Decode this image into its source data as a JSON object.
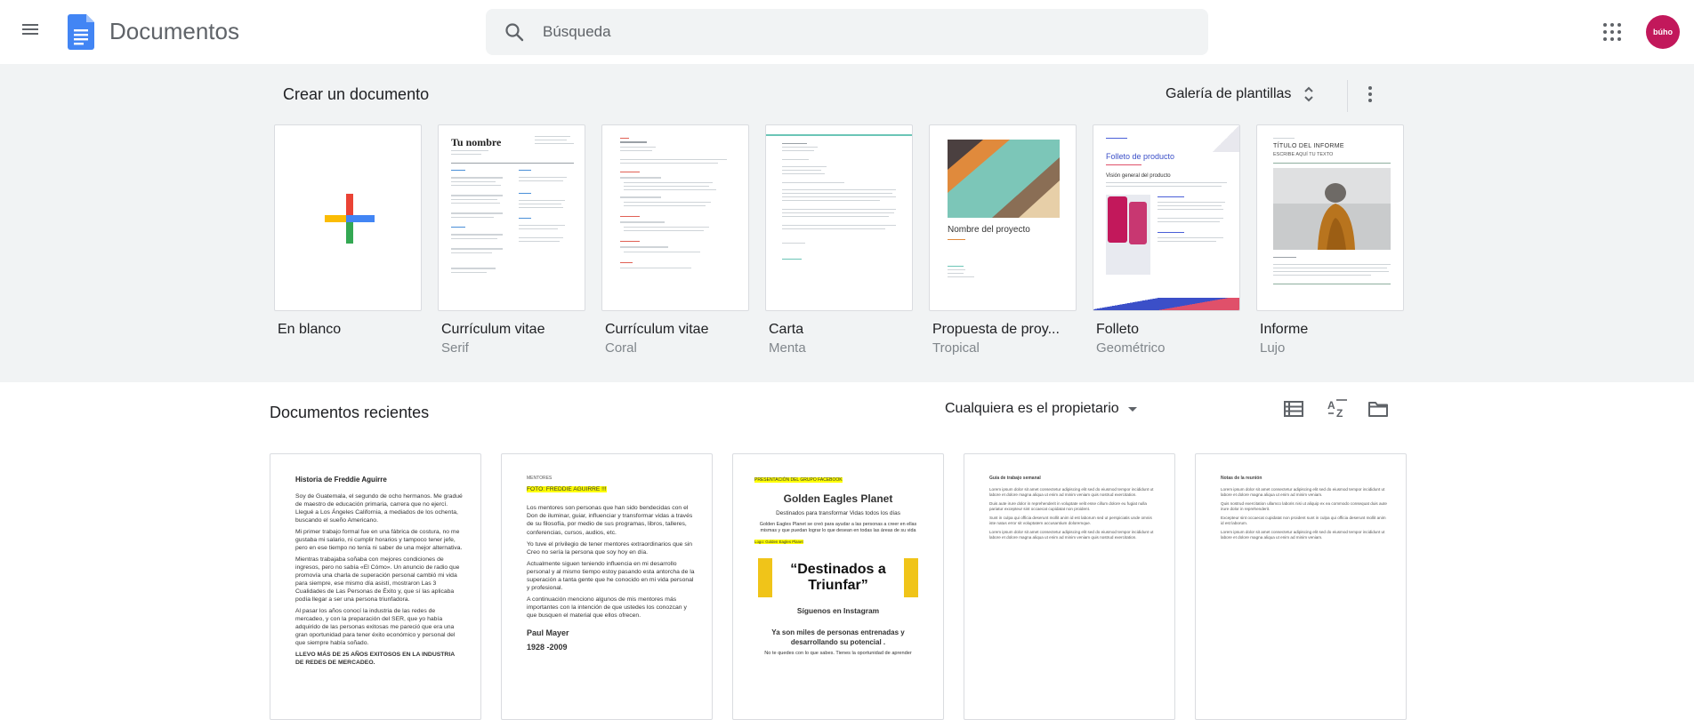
{
  "app": {
    "title": "Documentos"
  },
  "search": {
    "placeholder": "Búsqueda"
  },
  "account": {
    "avatar_text": "búho"
  },
  "gallery": {
    "title": "Crear un documento",
    "gallery_link": "Galería de plantillas",
    "templates": [
      {
        "name": "En blanco",
        "sub": ""
      },
      {
        "name": "Currículum vitae",
        "sub": "Serif",
        "thumb_heading": "Tu nombre"
      },
      {
        "name": "Currículum vitae",
        "sub": "Coral"
      },
      {
        "name": "Carta",
        "sub": "Menta"
      },
      {
        "name": "Propuesta de proy...",
        "sub": "Tropical",
        "thumb_heading": "Nombre del proyecto"
      },
      {
        "name": "Folleto",
        "sub": "Geométrico",
        "thumb_heading": "Folleto de producto",
        "thumb_sub": "Visión general del producto"
      },
      {
        "name": "Informe",
        "sub": "Lujo",
        "thumb_heading": "TÍTULO DEL INFORME",
        "thumb_sub": "ESCRIBE AQUÍ TU TEXTO"
      }
    ]
  },
  "recent": {
    "title": "Documentos recientes",
    "owner_filter": "Cualquiera es el propietario",
    "docs": [
      {
        "heading": "Historia de Freddie Aguirre",
        "paras": [
          "Soy de Guatemala, el segundo de ocho hermanos. Me gradué de maestro de educación primaria, carrera que no ejercí. Llegué a Los Ángeles California, a mediados de los ochenta, buscando el sueño Americano.",
          "Mi primer trabajo formal fue en una fábrica de costura, no me gustaba mi salario, ni cumplir horarios y tampoco tener jefe, pero en ese tiempo no tenía ni saber de una mejor alternativa.",
          "Mientras trabajaba soñaba con mejores condiciones de ingresos, pero no sabía «El Cómo». Un anuncio de radio que promovía una charla de superación personal cambió mi vida para siempre, ese mismo día asistí, mostraron Las 3 Cualidades de Las Personas de Éxito y, que sí las aplicaba podía llegar a ser una persona triunfadora.",
          "Al pasar los años conocí la industria de las redes de mercadeo, y con la preparación del SER, que yo había adquirido de las personas exitosas me pareció que era una gran oportunidad para tener éxito económico y personal del que siempre había soñado.",
          "LLEVO MÁS DE 25 AÑOS EXITOSOS EN LA INDUSTRIA DE REDES DE MERCADEO."
        ]
      },
      {
        "label": "MENTORES",
        "highlight": "FOTO: FREDDIE AGUIRRE !!!",
        "paras": [
          "Los mentores son personas que han sido bendecidas con el Don de iluminar, guiar, influenciar y transformar vidas a través de su filosofía, por medio de sus programas, libros, talleres, conferencias, cursos, audios, etc.",
          "Yo tuve el privilegio de tener mentores extraordinarios que sin Creo no sería la persona que soy hoy en día.",
          "Actualmente siguen teniendo influencia en mi desarrollo personal y al mismo tiempo estoy pasando esta antorcha de la superación a tanta gente que he conocido en mi vida personal y profesional.",
          "A continuación menciono algunos de mis mentores más importantes con la intención de que ustedes los conozcan y que busquen el material que ellos ofrecen."
        ],
        "signature_name": "Paul Mayer",
        "signature_years": "1928 -2009"
      },
      {
        "topline": "PRESENTACIÓN DEL GRUPO FACEBOOK",
        "title": "Golden Eagles Planet",
        "subtitle": "Destinados para transformar Vidas todos los días",
        "intro": "Golden Eagles Planet se creó para ayudar a las personas a creer en ellas mismas y que puedan lograr lo que desean en todas las áreas de su vida",
        "tag": "Logo: Golden Eagles Planet",
        "banner_line1": "“Destinados a",
        "banner_line2": "Triunfar”",
        "cta": "Síguenos en Instagram",
        "closing": "Ya son miles de personas entrenadas y desarrollando su potencial .",
        "footer": "No te quedes con lo que sabes. Tienes la oportunidad de aprender"
      },
      {
        "heading": "Guía de trabajo semanal",
        "paras": [
          "Lorem ipsum dolor sit amet consectetur adipiscing elit sed do eiusmod tempor incididunt ut labore et dolore magna aliqua ut enim ad minim veniam quis nostrud exercitation.",
          "Duis aute irure dolor in reprehenderit in voluptate velit esse cillum dolore eu fugiat nulla pariatur excepteur sint occaecat cupidatat non proident.",
          "Sunt in culpa qui officia deserunt mollit anim id est laborum sed ut perspiciatis unde omnis iste natus error sit voluptatem accusantium doloremque."
        ]
      },
      {
        "heading": "Notas de la reunión",
        "paras": [
          "Lorem ipsum dolor sit amet consectetur adipiscing elit sed do eiusmod tempor incididunt ut labore et dolore magna aliqua ut enim ad minim veniam.",
          "Quis nostrud exercitation ullamco laboris nisi ut aliquip ex ea commodo consequat duis aute irure dolor in reprehenderit.",
          "Excepteur sint occaecat cupidatat non proident sunt in culpa qui officia deserunt mollit anim id est laborum."
        ]
      }
    ]
  },
  "colors": {
    "gallery_bg": "#f1f3f4",
    "docs_blue": "#4285f4",
    "plus_red": "#ea4335",
    "plus_yellow": "#fbbc04",
    "plus_green": "#34a853",
    "highlight_yellow": "#ffff00",
    "banner_yellow": "#f0c419",
    "avatar_pink": "#c2185b"
  }
}
